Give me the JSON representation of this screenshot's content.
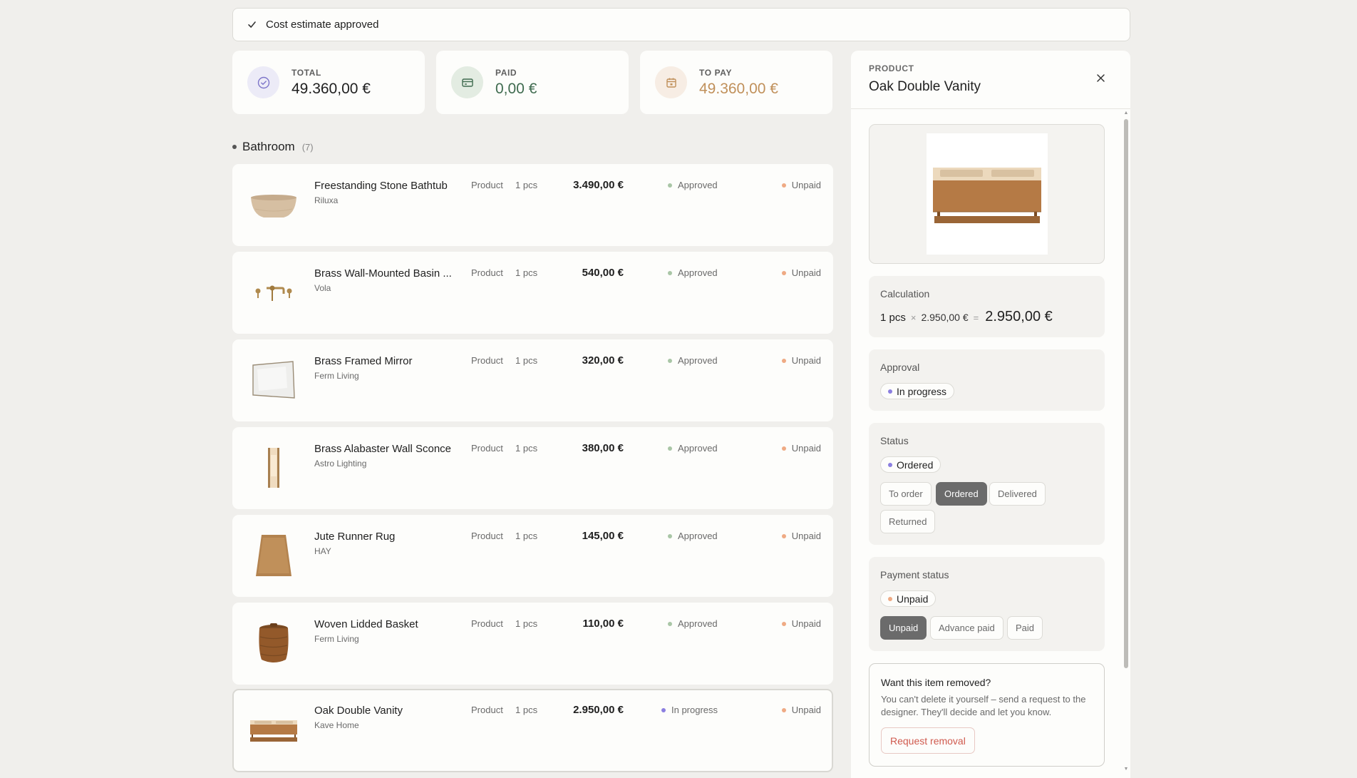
{
  "banner": {
    "text": "Cost estimate approved"
  },
  "summary": {
    "total": {
      "label": "TOTAL",
      "value": "49.360,00 €"
    },
    "paid": {
      "label": "PAID",
      "value": "0,00 €"
    },
    "to_pay": {
      "label": "TO PAY",
      "value": "49.360,00 €"
    }
  },
  "section": {
    "name": "Bathroom",
    "count": "(7)"
  },
  "rows": [
    {
      "title": "Freestanding Stone Bathtub",
      "brand": "Riluxa",
      "type": "Product",
      "qty": "1 pcs",
      "price": "3.490,00 €",
      "approval": "Approved",
      "payment": "Unpaid"
    },
    {
      "title": "Brass Wall-Mounted Basin ...",
      "brand": "Vola",
      "type": "Product",
      "qty": "1 pcs",
      "price": "540,00 €",
      "approval": "Approved",
      "payment": "Unpaid"
    },
    {
      "title": "Brass Framed Mirror",
      "brand": "Ferm Living",
      "type": "Product",
      "qty": "1 pcs",
      "price": "320,00 €",
      "approval": "Approved",
      "payment": "Unpaid"
    },
    {
      "title": "Brass Alabaster Wall Sconce",
      "brand": "Astro Lighting",
      "type": "Product",
      "qty": "1 pcs",
      "price": "380,00 €",
      "approval": "Approved",
      "payment": "Unpaid"
    },
    {
      "title": "Jute Runner Rug",
      "brand": "HAY",
      "type": "Product",
      "qty": "1 pcs",
      "price": "145,00 €",
      "approval": "Approved",
      "payment": "Unpaid"
    },
    {
      "title": "Woven Lidded Basket",
      "brand": "Ferm Living",
      "type": "Product",
      "qty": "1 pcs",
      "price": "110,00 €",
      "approval": "Approved",
      "payment": "Unpaid"
    },
    {
      "title": "Oak Double Vanity",
      "brand": "Kave Home",
      "type": "Product",
      "qty": "1 pcs",
      "price": "2.950,00 €",
      "approval": "In progress",
      "payment": "Unpaid"
    }
  ],
  "panel": {
    "label": "PRODUCT",
    "title": "Oak Double Vanity",
    "calculation": {
      "heading": "Calculation",
      "qty": "1 pcs",
      "times": "×",
      "unit_price": "2.950,00 €",
      "equals": "=",
      "result": "2.950,00 €"
    },
    "approval": {
      "heading": "Approval",
      "current": "In progress"
    },
    "status": {
      "heading": "Status",
      "current": "Ordered",
      "options": [
        "To order",
        "Ordered",
        "Delivered",
        "Returned"
      ]
    },
    "payment": {
      "heading": "Payment status",
      "current": "Unpaid",
      "options": [
        "Unpaid",
        "Advance paid",
        "Paid"
      ]
    },
    "removal": {
      "heading": "Want this item removed?",
      "body": "You can't delete it yourself – send a request to the designer. They'll decide and let you know.",
      "button": "Request removal"
    }
  },
  "colors": {
    "approved_dot": "#a9c6a6",
    "in_progress_dot": "#8b7fe0",
    "unpaid_dot": "#efaa84",
    "ordered_dot": "#8b7fe0",
    "to_pay_value": "#c0905a",
    "paid_value": "#3f6b4f",
    "danger": "#d05a4e"
  },
  "icons": {
    "banner": "check-icon",
    "total": "check-circle-icon",
    "paid": "card-icon",
    "to_pay": "calendar-icon",
    "close": "close-icon"
  }
}
